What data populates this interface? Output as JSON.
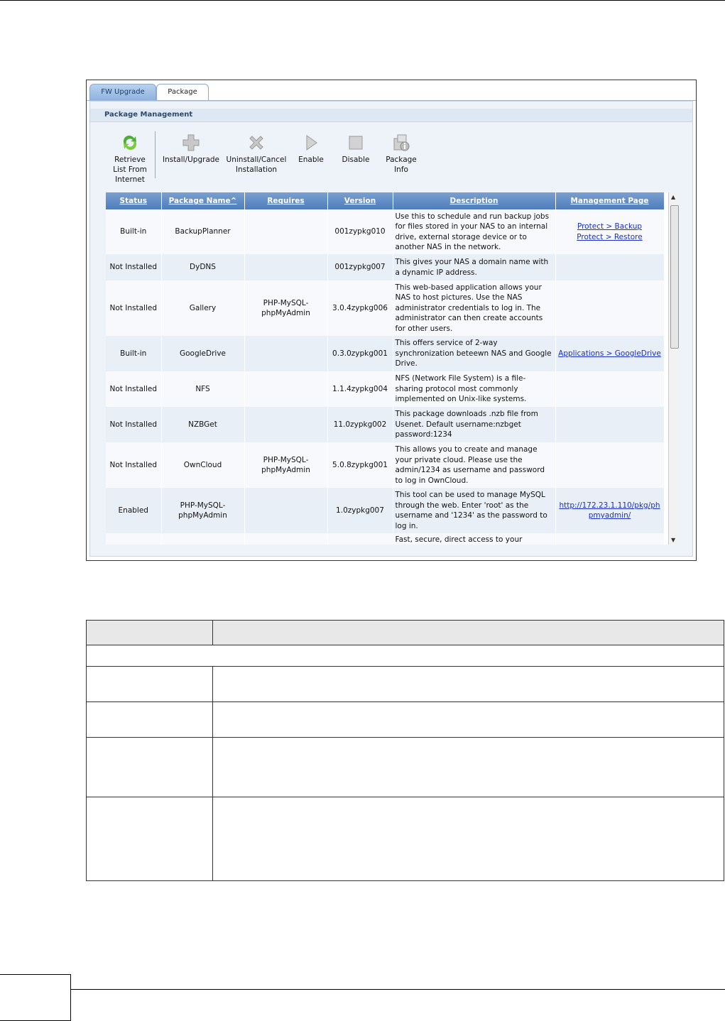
{
  "tabs": [
    {
      "label": "FW Upgrade"
    },
    {
      "label": "Package"
    }
  ],
  "panel_title": "Package Management",
  "toolbar": {
    "retrieve": "Retrieve List From Internet",
    "install": "Install/Upgrade",
    "uninstall": "Uninstall/Cancel Installation",
    "enable": "Enable",
    "disable": "Disable",
    "info": "Package Info"
  },
  "columns": [
    "Status",
    "Package Name^",
    "Requires",
    "Version",
    "Description",
    "Management Page"
  ],
  "rows": [
    {
      "status": "Built-in",
      "name": "BackupPlanner",
      "requires": "",
      "version": "001zypkg010",
      "description": "Use this to schedule and run backup jobs for files stored in your NAS to an internal drive, external storage device or to another NAS in the network.",
      "links": [
        "Protect > Backup",
        "Protect > Restore"
      ]
    },
    {
      "status": "Not Installed",
      "name": "DyDNS",
      "requires": "",
      "version": "001zypkg007",
      "description": "This gives your NAS a domain name with a dynamic IP address.",
      "links": []
    },
    {
      "status": "Not Installed",
      "name": "Gallery",
      "requires": "PHP-MySQL-phpMyAdmin",
      "version": "3.0.4zypkg006",
      "description": "This web-based application allows your NAS to host pictures. Use the NAS administrator credentials to log in. The administrator can then create accounts for other users.",
      "links": []
    },
    {
      "status": "Built-in",
      "name": "GoogleDrive",
      "requires": "",
      "version": "0.3.0zypkg001",
      "description": "This offers service of 2-way synchronization beteewn NAS and Google Drive.",
      "links": [
        "Applications > GoogleDrive"
      ]
    },
    {
      "status": "Not Installed",
      "name": "NFS",
      "requires": "",
      "version": "1.1.4zypkg004",
      "description": "NFS (Network File System) is a file-sharing protocol most commonly implemented on Unix-like systems.",
      "links": []
    },
    {
      "status": "Not Installed",
      "name": "NZBGet",
      "requires": "",
      "version": "11.0zypkg002",
      "description": "This package downloads .nzb file from Usenet. Default username:nzbget password:1234",
      "links": []
    },
    {
      "status": "Not Installed",
      "name": "OwnCloud",
      "requires": "PHP-MySQL-phpMyAdmin",
      "version": "5.0.8zypkg001",
      "description": "This allows you to create and manage your private cloud. Please use the admin/1234 as username and password to log in OwnCloud.",
      "links": []
    },
    {
      "status": "Enabled",
      "name": "PHP-MySQL-phpMyAdmin",
      "requires": "",
      "version": "1.0zypkg007",
      "description": "This tool can be used to manage MySQL through the web. Enter 'root' as the username and '1234' as the password to log in.",
      "links": [
        "http://172.23.1.110/pkg/phpmyadmin/"
      ]
    },
    {
      "status": "",
      "name": "",
      "requires": "",
      "version": "",
      "description": "Fast, secure, direct access to your",
      "links": []
    }
  ],
  "colors": {
    "header_blue": "#5a86c3",
    "link": "#1b2fc6",
    "panel_bg": "#eef3f9"
  }
}
